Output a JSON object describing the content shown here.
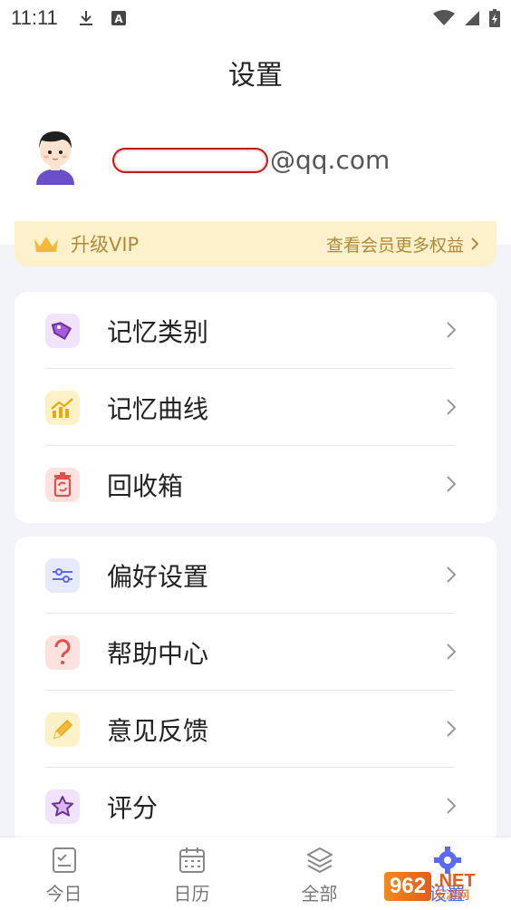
{
  "status_bar": {
    "time": "11:11",
    "icons": [
      "download-icon",
      "a-notification-icon",
      "wifi-icon",
      "signal-icon",
      "battery-charging-icon"
    ]
  },
  "header": {
    "title": "设置"
  },
  "profile": {
    "account_suffix": "@qq.com"
  },
  "vip": {
    "label": "升级VIP",
    "link": "查看会员更多权益"
  },
  "group1": [
    {
      "label": "记忆类别",
      "icon": "tag-icon",
      "color": "#8a3ec9"
    },
    {
      "label": "记忆曲线",
      "icon": "chart-icon",
      "color": "#e6a817"
    },
    {
      "label": "回收箱",
      "icon": "recycle-bin-icon",
      "color": "#e2504b"
    }
  ],
  "group2": [
    {
      "label": "偏好设置",
      "icon": "sliders-icon",
      "color": "#5b6af0"
    },
    {
      "label": "帮助中心",
      "icon": "question-icon",
      "color": "#e2504b"
    },
    {
      "label": "意见反馈",
      "icon": "pencil-icon",
      "color": "#e6a817"
    },
    {
      "label": "评分",
      "icon": "star-icon",
      "color": "#8a3ec9"
    }
  ],
  "bottom_nav": [
    {
      "label": "今日",
      "icon": "checklist-icon",
      "active": false
    },
    {
      "label": "日历",
      "icon": "calendar-icon",
      "active": false
    },
    {
      "label": "全部",
      "icon": "layers-icon",
      "active": false
    },
    {
      "label": "设置",
      "icon": "gear-icon",
      "active": true
    }
  ],
  "watermark": {
    "brand": "962",
    "domain": ".NET",
    "caption": "乐游网"
  }
}
